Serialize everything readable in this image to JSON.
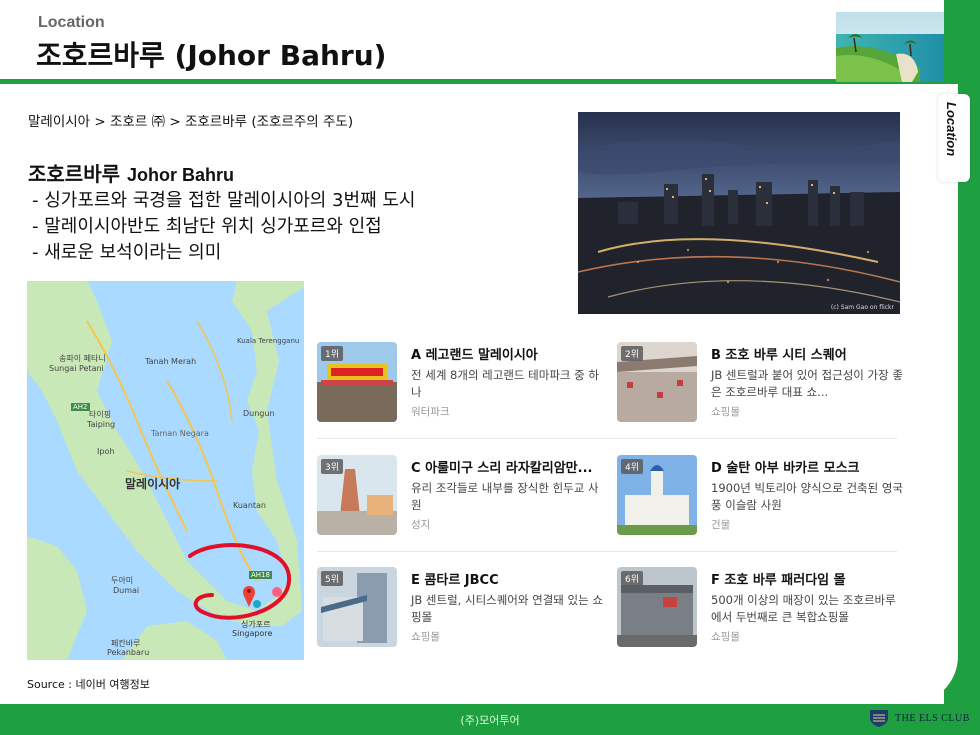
{
  "header": {
    "small_title": "Location",
    "big_title": "조호르바루 (Johor Bahru)"
  },
  "side_tab": {
    "label": "Location"
  },
  "breadcrumb": "말레이시아 > 조호르 ㈜ > 조호르바루 (조호르주의 주도)",
  "intro": {
    "title_ko": "조호르바루",
    "title_en": "Johor Bahru",
    "bullets": [
      "- 싱가포르와 국경을 접한 말레이시아의 3번째 도시",
      "- 말레이시아반도 최남단 위치 싱가포르와 인접",
      "- 새로운 보석이라는 의미"
    ]
  },
  "photo_credit": "(c) Sam Gao on flickr",
  "map": {
    "labels": [
      "송파이 페타니",
      "Sungai Petani",
      "Tanah Merah",
      "타이핑",
      "Taiping",
      "말레이시아",
      "Dungun",
      "Kuala Terengganu",
      "두아미",
      "Dumai",
      "싱가포르",
      "Singapore",
      "페칸바루",
      "Pekanbaru",
      "Taman Negara",
      "AH2",
      "AH18",
      "Ipoh",
      "Kuantan"
    ]
  },
  "source": "Source : 네이버 여행정보",
  "attractions": [
    {
      "rank": "1위",
      "title": "A 레고랜드 말레이시아",
      "desc": "전 세계 8개의 레고랜드 테마파크 중 하나",
      "category": "워터파크"
    },
    {
      "rank": "2위",
      "title": "B 조호 바루 시티 스퀘어",
      "desc": "JB 센트럴과 붙어 있어 접근성이 가장 좋은 조호르바루 대표 쇼...",
      "category": "쇼핑몰"
    },
    {
      "rank": "3위",
      "title": "C 아룰미구 스리 라자칼리암만...",
      "desc": "유리 조각들로 내부를 장식한 힌두교 사원",
      "category": "성지"
    },
    {
      "rank": "4위",
      "title": "D 술탄 아부 바카르 모스크",
      "desc": "1900년 빅토리아 양식으로 건축된 영국풍 이슬람 사원",
      "category": "건물"
    },
    {
      "rank": "5위",
      "title": "E 콤타르 JBCC",
      "desc": "JB 센트럴, 시티스퀘어와 연결돼 있는 쇼핑몰",
      "category": "쇼핑몰"
    },
    {
      "rank": "6위",
      "title": "F 조호 바루 패러다임 몰",
      "desc": "500개 이상의 매장이 있는 조호르바루에서 두번째로 큰 복합쇼핑몰",
      "category": "쇼핑몰"
    }
  ],
  "footer": {
    "company": "(주)모어투어",
    "logo_text": "THE ELS CLUB"
  }
}
